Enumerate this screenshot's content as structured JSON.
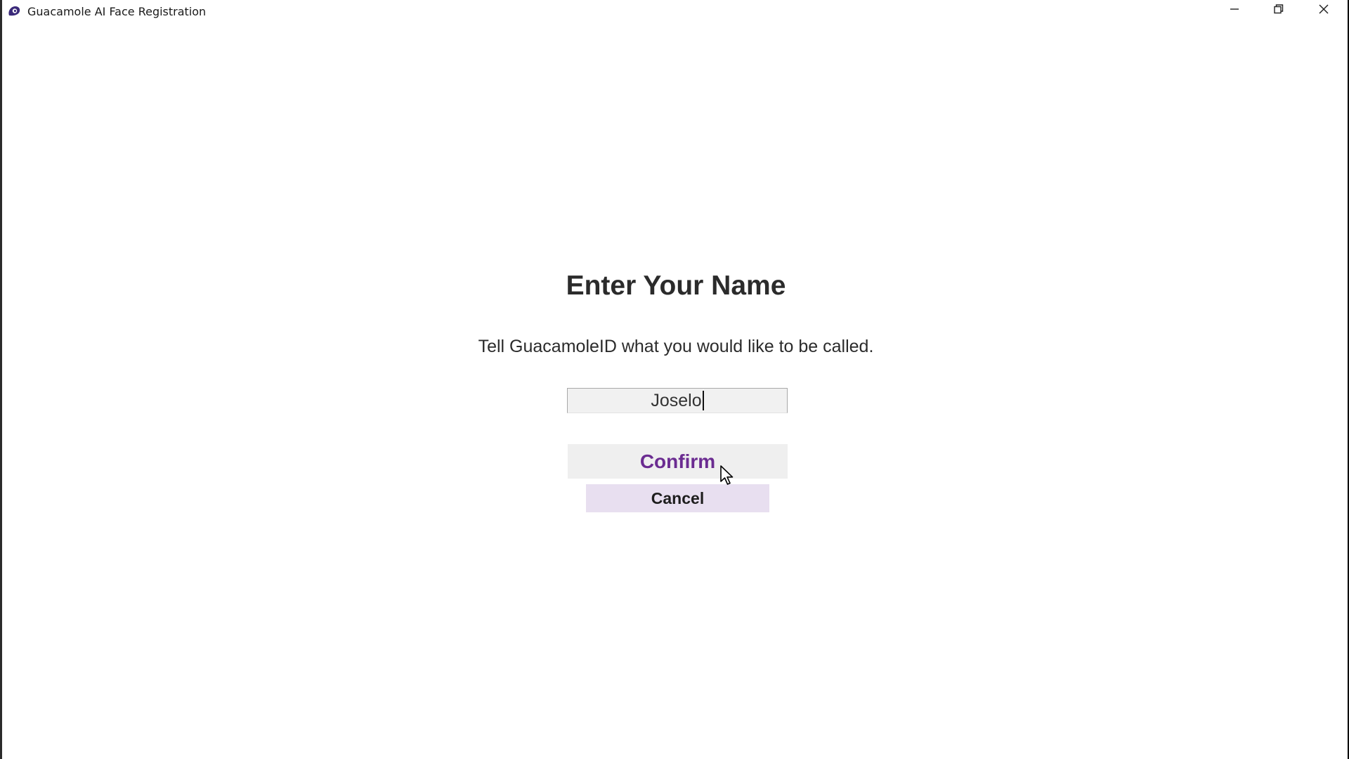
{
  "window": {
    "title": "Guacamole AI Face Registration",
    "app_icon": "guacamole-app-icon",
    "controls": {
      "minimize_icon": "minimize-icon",
      "maximize_icon": "restore-icon",
      "close_icon": "close-icon"
    }
  },
  "dialog": {
    "heading": "Enter Your Name",
    "subtitle": "Tell GuacamoleID what you would like to be called.",
    "name_input": {
      "value": "Joselo"
    },
    "confirm_label": "Confirm",
    "cancel_label": "Cancel"
  },
  "colors": {
    "accent": "#6b2c91",
    "cancel_bg": "#e8dff0",
    "button_bg": "#efefef",
    "app_icon": "#3b2a7a"
  },
  "mouse_cursor_icon": "mouse-pointer-icon"
}
